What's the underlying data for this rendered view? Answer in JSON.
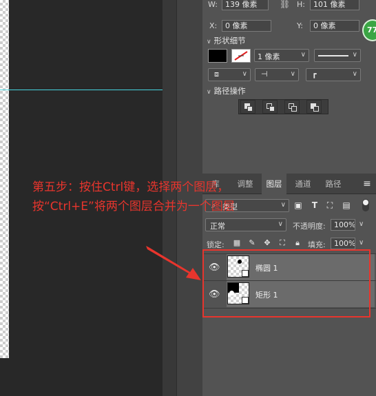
{
  "properties": {
    "w_label": "W:",
    "w_value": "139 像素",
    "h_label": "H:",
    "h_value": "101 像素",
    "x_label": "X:",
    "x_value": "0 像素",
    "y_label": "Y:",
    "y_value": "0 像素",
    "shape_details_label": "形状细节",
    "stroke_width": "1 像素",
    "path_ops_label": "路径操作"
  },
  "layers_panel": {
    "tabs": [
      "库",
      "调整",
      "图层",
      "通道",
      "路径"
    ],
    "active_tab": "图层",
    "filter_type": "类型",
    "blend_mode": "正常",
    "opacity_label": "不透明度:",
    "opacity_value": "100%",
    "lock_label": "锁定:",
    "fill_label": "填充:",
    "fill_value": "100%",
    "layers": [
      {
        "name": "椭圆 1"
      },
      {
        "name": "矩形 1"
      }
    ]
  },
  "annotation": {
    "line1": "第五步：按住Ctrl键，选择两个图层，",
    "line2": "按“Ctrl+E”将两个图层合并为一个图层",
    "color": "#e8352d"
  },
  "badge": {
    "text": "77"
  }
}
